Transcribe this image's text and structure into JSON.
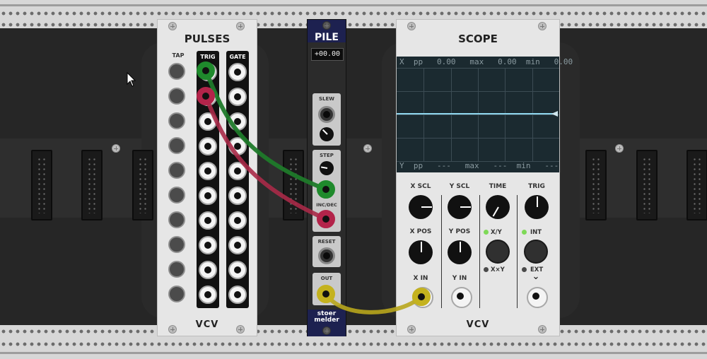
{
  "rack": {
    "modules": {
      "pulses": {
        "title": "PULSES",
        "tap_label": "TAP",
        "trig_label": "TRIG",
        "gate_label": "GATE",
        "brand": "VCV"
      },
      "pile": {
        "title": "PILE",
        "display_value": "+00.00",
        "slew_label": "SLEW",
        "step_label": "STEP",
        "incdec_label": "INC/DEC",
        "reset_label": "RESET",
        "out_label": "OUT",
        "brand_line1": "stoer",
        "brand_line2": "melder"
      },
      "scope": {
        "title": "SCOPE",
        "top_readout": {
          "channel": "X",
          "pp_label": "pp",
          "pp": "0.00",
          "max_label": "max",
          "max": "0.00",
          "min_label": "min",
          "min": "0.00"
        },
        "bottom_readout": {
          "channel": "Y",
          "pp_label": "pp",
          "pp": "---",
          "max_label": "max",
          "max": "---",
          "min_label": "min",
          "min": "---"
        },
        "x_scl_label": "X SCL",
        "y_scl_label": "Y SCL",
        "time_label": "TIME",
        "trig_label": "TRIG",
        "x_pos_label": "X POS",
        "y_pos_label": "Y POS",
        "xy_label": "X/Y",
        "xy_sum_label": "X×Y",
        "int_label": "INT",
        "ext_label": "EXT",
        "x_in_label": "X IN",
        "y_in_label": "Y IN",
        "chevron": "⌄",
        "brand": "VCV"
      }
    },
    "colors": {
      "cable_green": "#1f7a2a",
      "cable_red": "#a82a48",
      "cable_yellow": "#b8a61c",
      "scope_trace": "#8fd7ef",
      "led_green": "#7ed957"
    }
  }
}
